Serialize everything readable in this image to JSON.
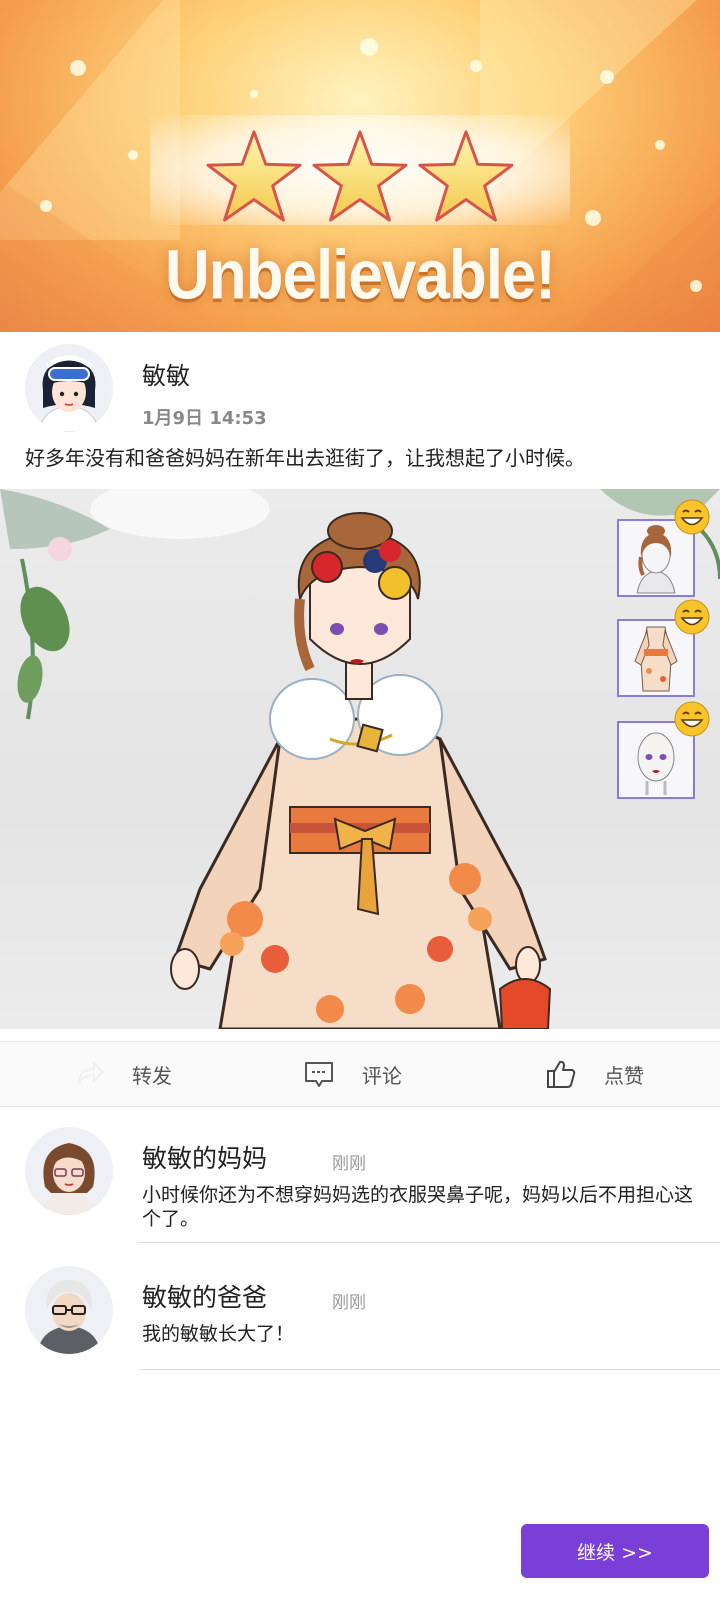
{
  "rating": {
    "title": "Unbelievable!",
    "stars_filled": 3,
    "stars_total": 3
  },
  "post": {
    "author": "敏敏",
    "time": "1月9日 14:53",
    "text": "好多年没有和爸爸妈妈在新年出去逛街了，让我想起了小时候。"
  },
  "outfit_items": [
    {
      "icon": "hairstyle-icon",
      "reaction": "laughing-emoji-icon"
    },
    {
      "icon": "kimono-outfit-icon",
      "reaction": "laughing-emoji-icon"
    },
    {
      "icon": "face-makeup-icon",
      "reaction": "laughing-emoji-icon"
    }
  ],
  "actions": {
    "share": "转发",
    "comment": "评论",
    "like": "点赞"
  },
  "comments": [
    {
      "name": "敏敏的妈妈",
      "time": "刚刚",
      "text": "小时候你还为不想穿妈妈选的衣服哭鼻子呢，妈妈以后不用担心这个了。"
    },
    {
      "name": "敏敏的爸爸",
      "time": "刚刚",
      "text": "我的敏敏长大了！"
    }
  ],
  "continue_label": "继续 >>",
  "colors": {
    "accent": "#7a3fd6",
    "card_border": "#8a7cd8",
    "banner_orange": "#f6a24f"
  }
}
